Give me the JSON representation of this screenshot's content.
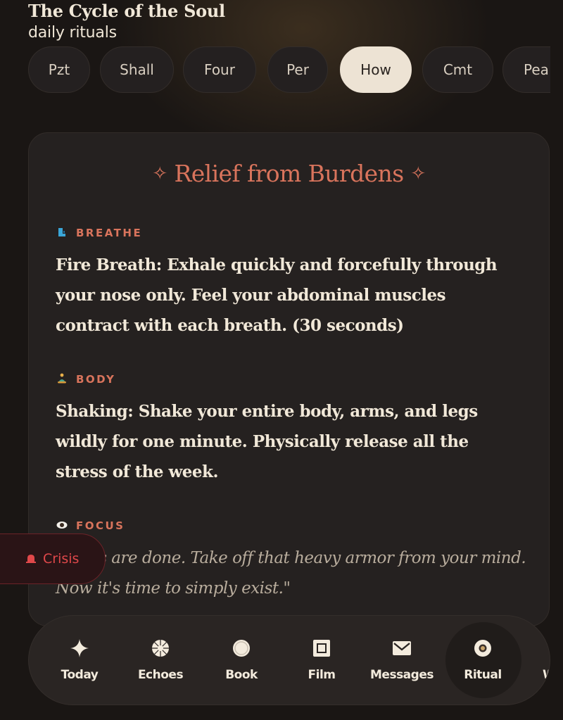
{
  "header": {
    "title": "The Cycle of the Soul",
    "subtitle": "daily rituals"
  },
  "pills": [
    {
      "label": "Pzt",
      "active": false
    },
    {
      "label": "Shall",
      "active": false
    },
    {
      "label": "Four",
      "active": false
    },
    {
      "label": "Per",
      "active": false
    },
    {
      "label": "How",
      "active": true
    },
    {
      "label": "Cmt",
      "active": false
    },
    {
      "label": "Pea",
      "active": false
    }
  ],
  "card": {
    "title": "Relief from Burdens",
    "title_sparkle": "✧",
    "sections": [
      {
        "label": "BREATHE",
        "icon": "lungs-icon",
        "text": "Fire Breath: Exhale quickly and forcefully through your nose only. Feel your abdominal muscles contract with each breath. (30 seconds)"
      },
      {
        "label": "BODY",
        "icon": "meditation-icon",
        "text": "Shaking: Shake your entire body, arms, and legs wildly for one minute. Physically release all the stress of the week."
      },
      {
        "label": "FOCUS",
        "icon": "eye-icon",
        "text": "\"Tasks are done. Take off that heavy armor from your mind. Now it's time to simply exist.\""
      }
    ]
  },
  "crisis": {
    "label": "Crisis",
    "icon": "siren-icon"
  },
  "nav": {
    "items": [
      {
        "label": "Today",
        "icon": "sparkle-icon",
        "active": false
      },
      {
        "label": "Echoes",
        "icon": "burst-icon",
        "active": false
      },
      {
        "label": "Book",
        "icon": "circle-icon",
        "active": false
      },
      {
        "label": "Film",
        "icon": "film-frame-icon",
        "active": false
      },
      {
        "label": "Messages",
        "icon": "envelope-icon",
        "active": false
      },
      {
        "label": "Ritual",
        "icon": "ring-icon",
        "active": true
      }
    ],
    "peek_label": "W"
  },
  "colors": {
    "background": "#1a1614",
    "accent": "#d9745c",
    "crisis": "#e0484a",
    "active_pill": "#ede3d4"
  }
}
